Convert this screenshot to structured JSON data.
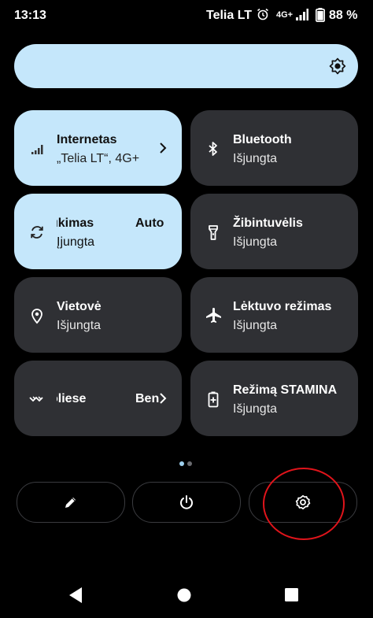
{
  "status_bar": {
    "time": "13:13",
    "carrier": "Telia LT",
    "network": "4G+",
    "battery_percent": "88 %",
    "icons": [
      "alarm-icon",
      "signal-icon",
      "battery-icon"
    ]
  },
  "brightness": {
    "icon": "brightness-icon",
    "accent": "#c5e7fb"
  },
  "tiles": [
    {
      "label": "Internetas",
      "sub": "„Telia LT“, 4G+",
      "icon": "mobile-data-icon",
      "state": "on",
      "has_chevron": true
    },
    {
      "label": "Bluetooth",
      "sub": "Išjungta",
      "icon": "bluetooth-icon",
      "state": "off"
    },
    {
      "label_part1": "ukimas",
      "label_part2": "Auto",
      "sub": "Įjungta",
      "icon": "auto-rotate-icon",
      "state": "on"
    },
    {
      "label": "Žibintuvėlis",
      "sub": "Išjungta",
      "icon": "flashlight-icon",
      "state": "off"
    },
    {
      "label": "Vietovė",
      "sub": "Išjungta",
      "icon": "location-icon",
      "state": "off"
    },
    {
      "label": "Lėktuvo režimas",
      "sub": "Išjungta",
      "icon": "airplane-icon",
      "state": "off"
    },
    {
      "label_part1": "oliese",
      "label_part2": "Ben",
      "icon": "nearby-share-icon",
      "state": "off",
      "has_chevron": true
    },
    {
      "label": "Režimą STAMINA",
      "sub": "Išjungta",
      "icon": "battery-saver-icon",
      "state": "off"
    }
  ],
  "page_indicator": {
    "pages": 2,
    "current": 1
  },
  "bottom_buttons": [
    "edit-icon",
    "power-icon",
    "settings-icon"
  ],
  "annotation_color": "#e0141b",
  "nav_bar": [
    "back-icon",
    "home-icon",
    "recents-icon"
  ]
}
